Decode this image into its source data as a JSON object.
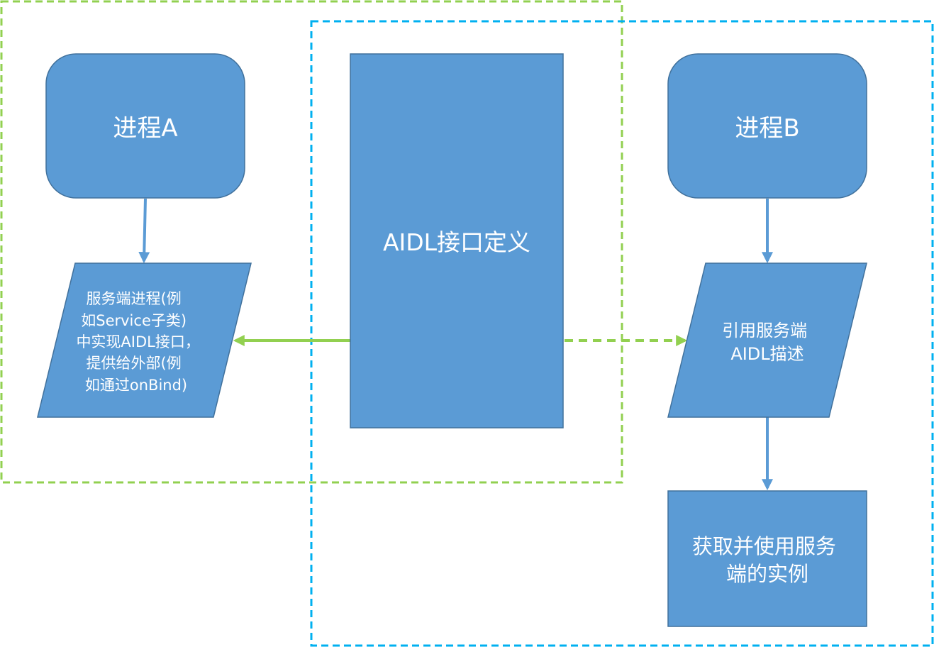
{
  "colors": {
    "shape_fill": "#5b9bd5",
    "shape_stroke": "#41719c",
    "green": "#92d050",
    "blue_dash": "#00b0f0",
    "arrow_blue": "#5b9bd5",
    "text": "#ffffff"
  },
  "nodes": {
    "process_a": {
      "label": "进程A"
    },
    "process_b": {
      "label": "进程B"
    },
    "aidl": {
      "label": "AIDL接口定义"
    },
    "server_impl": {
      "lines": [
        "服务端进程(例",
        "如Service子类)",
        "中实现AIDL接口，",
        "提供给外部(例",
        "如通过onBind)"
      ]
    },
    "client_ref": {
      "lines": [
        "引用服务端",
        "AIDL描述"
      ]
    },
    "client_use": {
      "lines": [
        "获取并使用服务",
        "端的实例"
      ]
    }
  }
}
